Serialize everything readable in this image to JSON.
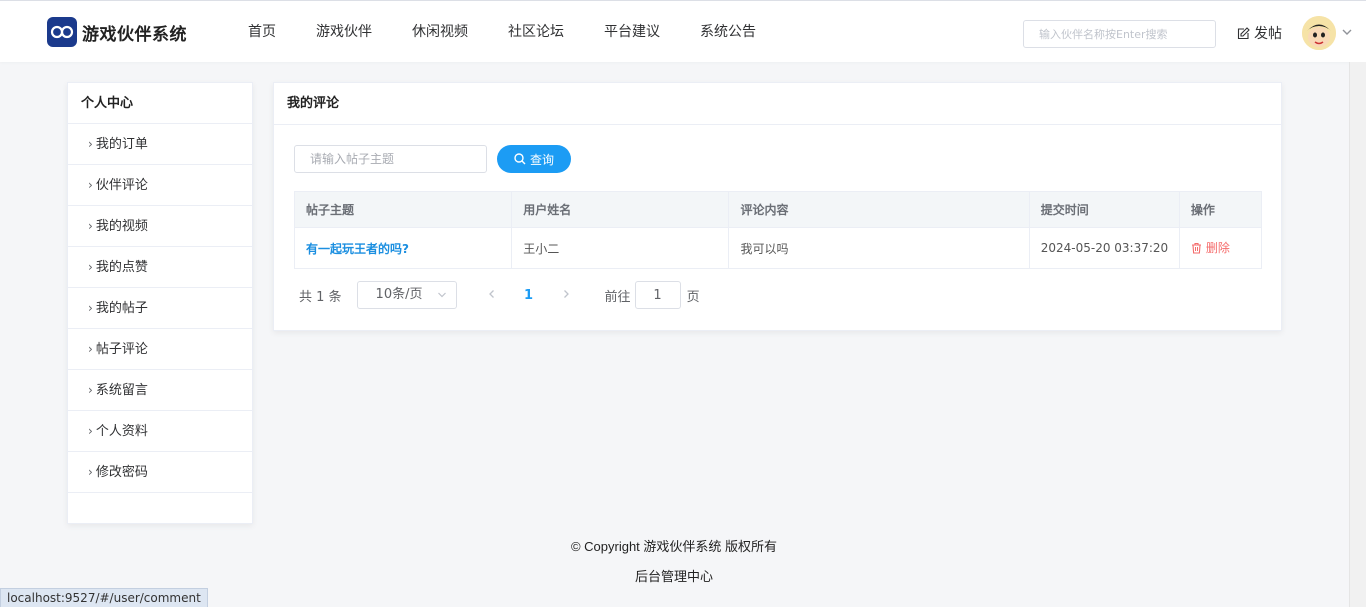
{
  "header": {
    "logo_text": "游戏伙伴系统",
    "nav": [
      "首页",
      "游戏伙伴",
      "休闲视频",
      "社区论坛",
      "平台建议",
      "系统公告"
    ],
    "search_placeholder": "输入伙伴名称按Enter搜索",
    "post_label": "发帖"
  },
  "sidebar": {
    "title": "个人中心",
    "items": [
      "我的订单",
      "伙伴评论",
      "我的视频",
      "我的点赞",
      "我的帖子",
      "帖子评论",
      "系统留言",
      "个人资料",
      "修改密码"
    ]
  },
  "main": {
    "title": "我的评论",
    "filter_placeholder": "请输入帖子主题",
    "query_label": "查询",
    "columns": [
      "帖子主题",
      "用户姓名",
      "评论内容",
      "提交时间",
      "操作"
    ],
    "rows": [
      {
        "topic": "有一起玩王者的吗?",
        "user": "王小二",
        "content": "我可以吗",
        "time": "2024-05-20 03:37:20",
        "action": "删除"
      }
    ],
    "pagination": {
      "total": "共 1 条",
      "page_size": "10条/页",
      "current_page": "1",
      "goto_prefix": "前往",
      "goto_value": "1",
      "goto_suffix": "页"
    }
  },
  "footer": {
    "copyright": "© Copyright 游戏伙伴系统 版权所有",
    "admin_link": "后台管理中心"
  },
  "status_bar": {
    "url": "localhost:9527/#/user/comment"
  },
  "colors": {
    "accent": "#1c9cf4",
    "danger": "#f56c6c",
    "logo_bg": "#1b3a8c"
  }
}
